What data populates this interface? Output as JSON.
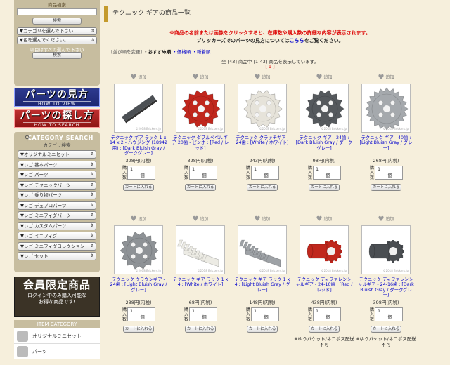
{
  "sidebar": {
    "search_heading": "商品検索",
    "search_button": "検索",
    "category_select": "▼カテゴリを選んで下さい",
    "color_select": "▼色を選んでください。",
    "note": "項目はすべて選んで下さい",
    "search_button2": "検索",
    "banner_view_big": "パーツの見方",
    "banner_view_small": "HOW TO VIEW",
    "banner_search_big": "パーツの探し方",
    "banner_search_small": "HOW TO SEARCH",
    "cat_search_en": "CATEGORY SEARCH",
    "cat_search_jp": "カテゴリ検索",
    "categories": [
      "▼オリジナルミニセット",
      "▼レゴ 基本パーツ",
      "▼レゴ パーツ",
      "▼レゴ テクニックパーツ",
      "▼レゴ 乗り物パーツ",
      "▼レゴ デュプロパーツ",
      "▼レゴ ミニフィグパーツ",
      "▼レゴ カスタムパーツ",
      "▼レゴ ミニフィグ",
      "▼レゴ ミニフィグコレクション",
      "▼レゴ セット"
    ],
    "member_big": "会員限定商品",
    "member_line1": "ログイン中のみ購入可能な",
    "member_line2": "お得な商品です!",
    "item_category": "ITEM CATEGORY",
    "item_rows": [
      "オリジナルミニセット",
      "パーツ"
    ]
  },
  "main": {
    "title": "テクニック ギアの商品一覧",
    "notice1": "※商品の名前または画像をクリックすると、在庫数や購入数の詳細な内容が表示されます。",
    "notice2_pre": "ブリッカーズでのパーツの見方については",
    "notice2_link": "こちら",
    "notice2_post": "をご覧ください。",
    "sort_label": "[並び順を変更]",
    "sort_current": "・おすすめ順",
    "sort_price": "・価格順",
    "sort_new": "・新着順",
    "count_text": "全 [43] 商品中 [1-43] 商品を表示しています。",
    "pages_text": "[ 1 ]",
    "fav_label": "追加",
    "unit": "個",
    "qty_label": [
      "購",
      "入",
      "数"
    ],
    "cart_label": "カートに入れる",
    "watermark": "©2018 Brickers.jp"
  },
  "products": [
    {
      "name": "テクニック ギア ラック 1 x 14 x 2 - ハウジング (18942用) : [Dark Bluish Gray / ダークグレー]",
      "price": "398円(内税)",
      "qty": "1",
      "color": "#4c5054",
      "kind": "rack_dark"
    },
    {
      "name": "テクニック ダブルベベルギア 20歯 - ピンホ : [Red / レッド]",
      "price": "328円(内税)",
      "qty": "1",
      "color": "#c0271d",
      "kind": "gear"
    },
    {
      "name": "テクニック クラッチギア - 24歯 : [White / ホワイト]",
      "price": "243円(内税)",
      "qty": "1",
      "color": "#e6e3da",
      "kind": "gear"
    },
    {
      "name": "テクニック ギア - 24歯 : [Dark Bluish Gray / ダークグレー]",
      "price": "98円(内税)",
      "qty": "1",
      "color": "#55595d",
      "kind": "gear"
    },
    {
      "name": "テクニック ギア - 40歯 : [Light Bluish Gray / グレー]",
      "price": "268円(内税)",
      "qty": "1",
      "color": "#a5a9ad",
      "kind": "gear"
    },
    {
      "name": "テクニック クラウンギア - 24歯 : [Light Bluish Gray / グレー]",
      "price": "238円(内税)",
      "qty": "1",
      "color": "#8e9296",
      "kind": "gear"
    },
    {
      "name": "テクニック ギア ラック 1 x 4 : [White / ホワイト]",
      "price": "68円(内税)",
      "qty": "1",
      "color": "#ecebe4",
      "kind": "rack"
    },
    {
      "name": "テクニック ギア ラック 1 x 4 : [Light Bluish Gray / グレー]",
      "price": "148円(内税)",
      "qty": "1",
      "color": "#9ea2a6",
      "kind": "rack"
    },
    {
      "name": "テクニック ディファレンシャルギア - 24-16歯 : [Red / レッド]",
      "price": "438円(内税)",
      "qty": "1",
      "color": "#c0271d",
      "kind": "diff",
      "shipping": "※ゆうパケット/ネコポス配送不可"
    },
    {
      "name": "テクニック ディファレンシャルギア - 24-16歯 : [Dark Bluish Gray / ダークグレー]",
      "price": "398円(内税)",
      "qty": "1",
      "color": "#4a4e52",
      "kind": "diff",
      "shipping": "※ゆうパケット/ネコポス配送不可"
    }
  ]
}
